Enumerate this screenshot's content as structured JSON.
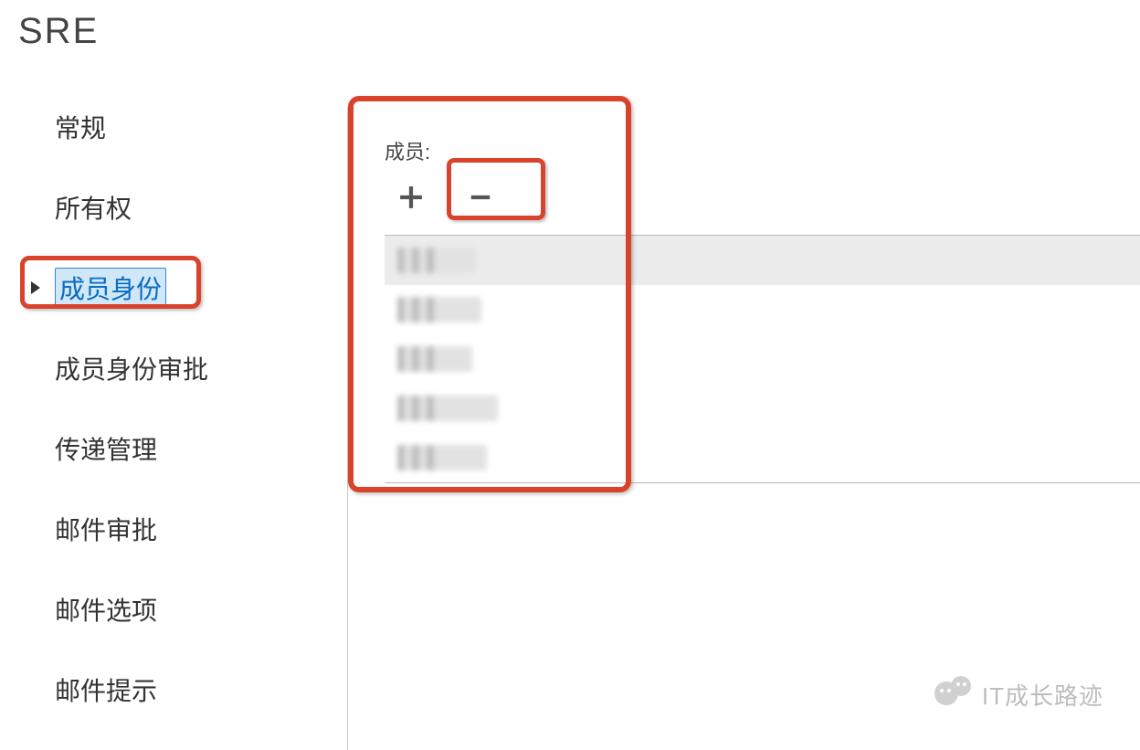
{
  "page_title": "SRE",
  "sidebar": {
    "items": [
      {
        "label": "常规"
      },
      {
        "label": "所有权"
      },
      {
        "label": "成员身份",
        "selected": true
      },
      {
        "label": "成员身份审批"
      },
      {
        "label": "传递管理"
      },
      {
        "label": "邮件审批"
      },
      {
        "label": "邮件选项"
      },
      {
        "label": "邮件提示"
      }
    ]
  },
  "main": {
    "members_label": "成员:",
    "members": [
      {
        "redacted_width": 86,
        "selected": true
      },
      {
        "redacted_width": 92
      },
      {
        "redacted_width": 82
      },
      {
        "redacted_width": 110
      },
      {
        "redacted_width": 98
      }
    ]
  },
  "watermark": "IT成长路迹"
}
